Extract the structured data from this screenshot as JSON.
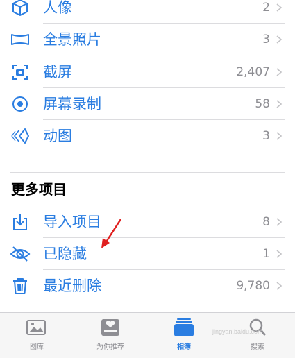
{
  "media_types": {
    "items": [
      {
        "label": "人像",
        "count": "2",
        "icon": "cube-icon"
      },
      {
        "label": "全景照片",
        "count": "3",
        "icon": "panorama-icon"
      },
      {
        "label": "截屏",
        "count": "2,407",
        "icon": "screenshot-icon"
      },
      {
        "label": "屏幕录制",
        "count": "58",
        "icon": "screen-record-icon"
      },
      {
        "label": "动图",
        "count": "3",
        "icon": "animated-icon"
      }
    ]
  },
  "more_items": {
    "title": "更多项目",
    "items": [
      {
        "label": "导入项目",
        "count": "8",
        "icon": "import-icon"
      },
      {
        "label": "已隐藏",
        "count": "1",
        "icon": "hidden-eye-icon"
      },
      {
        "label": "最近删除",
        "count": "9,780",
        "icon": "trash-icon"
      }
    ]
  },
  "tabbar": {
    "tabs": [
      {
        "label": "图库",
        "icon": "library-icon",
        "active": false
      },
      {
        "label": "为你推荐",
        "icon": "for-you-icon",
        "active": false
      },
      {
        "label": "相簿",
        "icon": "albums-icon",
        "active": true
      },
      {
        "label": "搜索",
        "icon": "search-icon",
        "active": false
      }
    ]
  },
  "watermark": "jingyan.baidu.com",
  "colors": {
    "accent": "#2a7de1",
    "secondary_text": "#8e8e93",
    "annotation_arrow": "#e02020"
  }
}
